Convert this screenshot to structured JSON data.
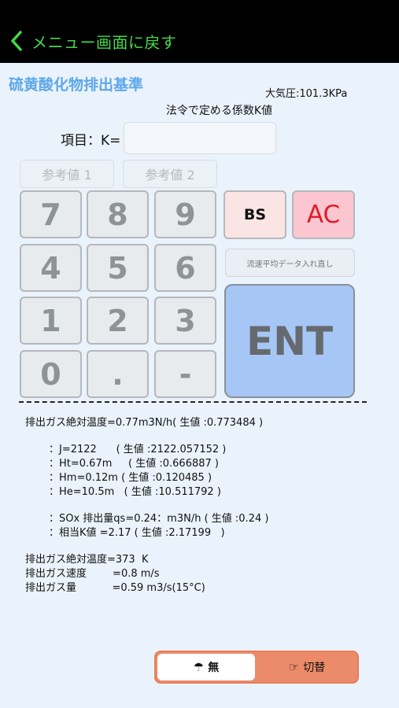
{
  "header": {
    "back_label": "メニュー画面に戻す"
  },
  "screen": {
    "title": "硫黄酸化物排出基準",
    "pressure": "大気圧:101.3KPa",
    "subtitle": "法令で定める係数K値",
    "k_label": "項目：K=",
    "k_value": ""
  },
  "ref_buttons": [
    "参考値 1",
    "参考値 2"
  ],
  "keypad": [
    "7",
    "8",
    "9",
    "4",
    "5",
    "6",
    "1",
    "2",
    "3",
    "0",
    ".",
    "-"
  ],
  "controls": {
    "bs": "BS",
    "ac": "AC",
    "reload": "流速平均データ入れ直し",
    "ent": "ENT"
  },
  "results": {
    "line1": "排出ガス絶対温度=0.77m3N/h( 生値 :0.773484 )",
    "line2": "：J=2122      ( 生値 :2122.057152 )",
    "line3": "：Ht=0.67m     ( 生値 :0.666887 )",
    "line4": "：Hm=0.12m ( 生値 :0.120485 )",
    "line5": "：He=10.5m   ( 生値 :10.511792 )",
    "line6": "：SOx 排出量qs=0.24：m3N/h ( 生値 :0.24 )",
    "line7": "：相当K値 =2.17 ( 生値 :2.17199   )",
    "line8": "排出ガス絶対温度=373  K",
    "line9": "排出ガス速度        =0.8 m/s",
    "line10": "排出ガス量           =0.59 m3/s(15°C)"
  },
  "toggle": {
    "on_label": "無",
    "off_label": "切替",
    "on_icon": "umbrella-icon",
    "off_icon": "pointing-hand-icon"
  }
}
